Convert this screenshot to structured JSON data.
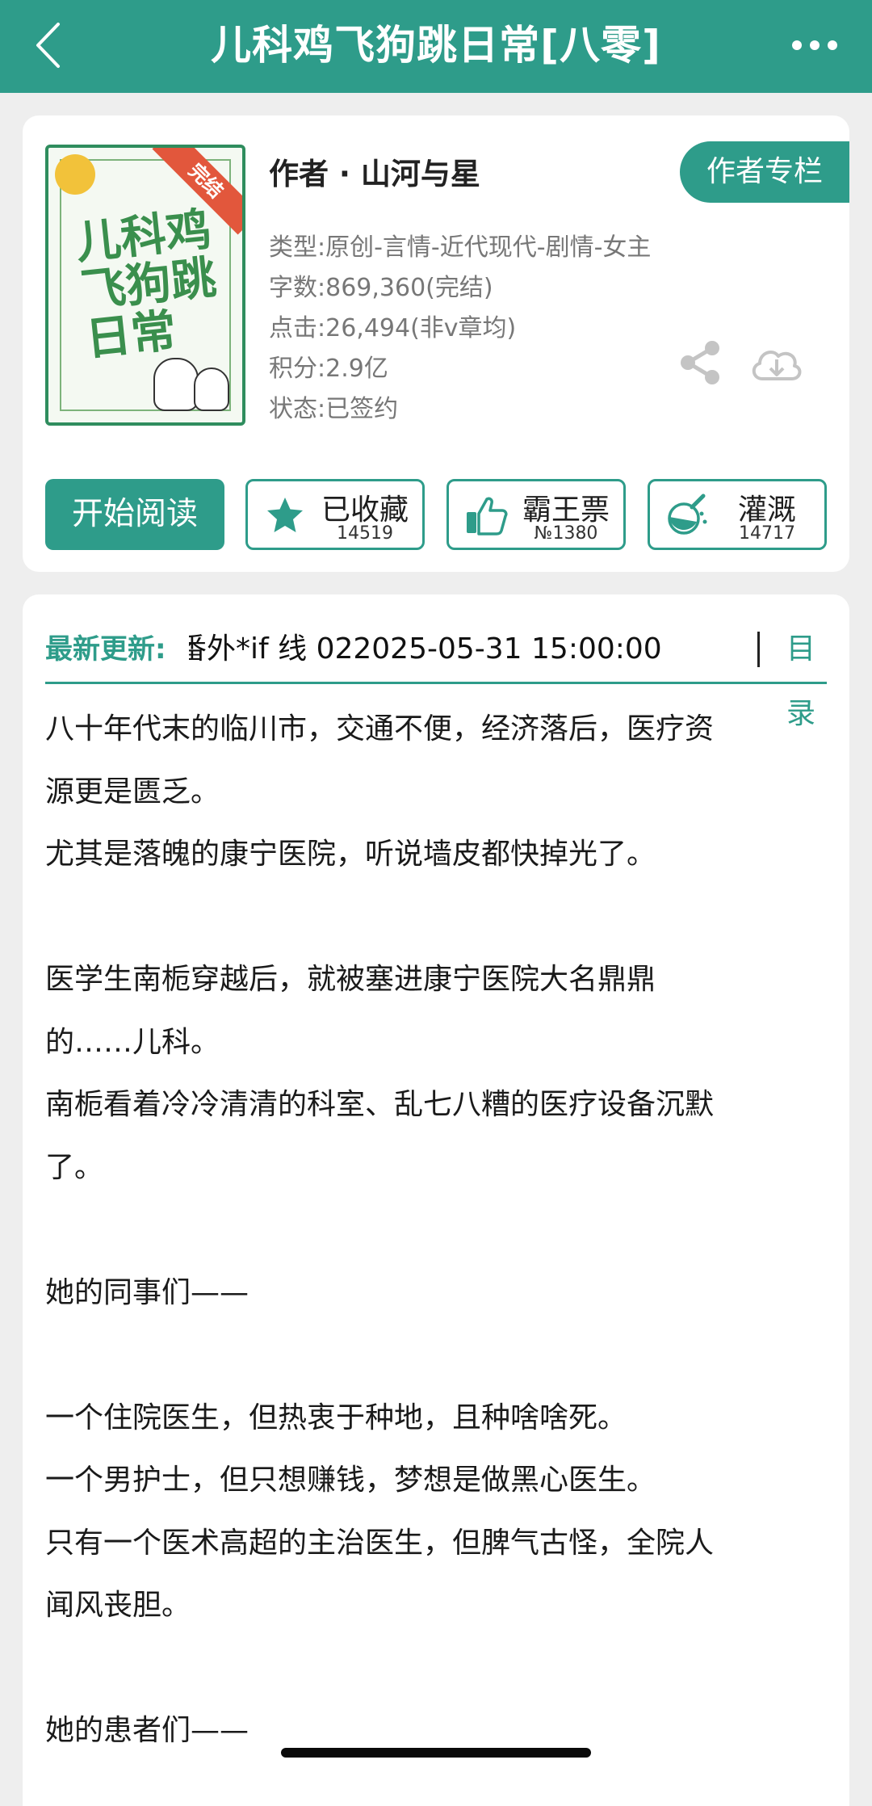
{
  "topbar": {
    "title": "儿科鸡飞狗跳日常[八零]",
    "back_icon": "chevron-left-icon",
    "more_icon": "more-dots-icon"
  },
  "book": {
    "cover": {
      "badge": "完结",
      "title_art": "儿科鸡飞狗跳日常"
    },
    "author_line": "作者 · 山河与星",
    "author_column_label": "作者专栏",
    "meta": [
      "类型:原创-言情-近代现代-剧情-女主",
      "字数:869,360(完结)",
      "点击:26,494(非v章均)",
      "积分:2.9亿",
      "状态:已签约"
    ]
  },
  "actions": {
    "read_label": "开始阅读",
    "favorite": {
      "label": "已收藏",
      "count": "14519"
    },
    "tyrant_ticket": {
      "label": "霸王票",
      "count": "№1380"
    },
    "irrigate": {
      "label": "灌溉",
      "count": "14717"
    }
  },
  "update": {
    "label": "最新更新:",
    "text": "番外*if 线 022025-05-31 15:00:00",
    "toc_label": "目录"
  },
  "description": [
    "八十年代末的临川市，交通不便，经济落后，医疗资",
    "源更是匮乏。",
    "尤其是落魄的康宁医院，听说墙皮都快掉光了。",
    "",
    "医学生南栀穿越后，就被塞进康宁医院大名鼎鼎",
    "的……儿科。",
    "南栀看着冷冷清清的科室、乱七八糟的医疗设备沉默",
    "了。",
    "",
    "她的同事们——",
    "",
    "一个住院医生，但热衷于种地，且种啥啥死。",
    "一个男护士，但只想赚钱，梦想是做黑心医生。",
    "只有一个医术高超的主治医生，但脾气古怪，全院人",
    "闻风丧胆。",
    "",
    "她的患者们——"
  ],
  "colors": {
    "accent": "#2e9c8a",
    "ribbon": "#e2573c"
  }
}
